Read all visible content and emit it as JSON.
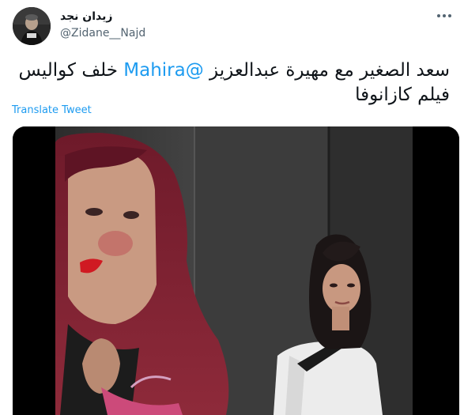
{
  "author": {
    "display_name": "زيدان نجد",
    "handle": "@Zidane__Najd"
  },
  "tweet": {
    "text_before": "سعد الصغير مع مهيرة عبدالعزيز ",
    "mention": "@Mahira",
    "text_after": " خلف كواليس فيلم كازانوفا"
  },
  "translate_label": "Translate Tweet",
  "icons": {
    "more": "more-options-icon",
    "avatar": "profile-avatar"
  }
}
